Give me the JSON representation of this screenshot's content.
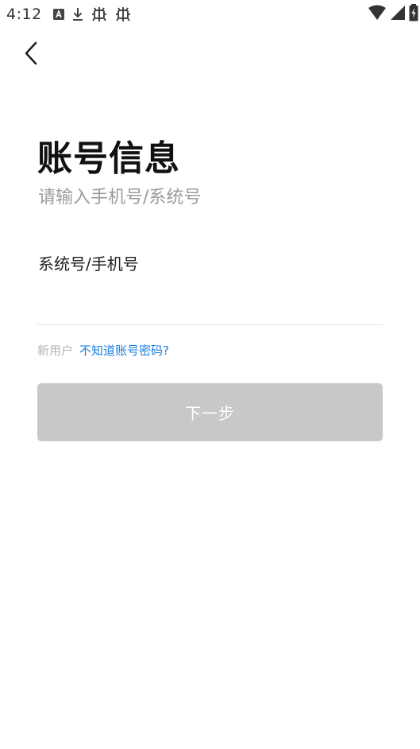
{
  "status_bar": {
    "time": "4:12",
    "left_icons": [
      "a-box-icon",
      "download-icon",
      "bug-icon",
      "bug-icon"
    ],
    "right_icons": [
      "wifi-icon",
      "signal-icon",
      "battery-icon"
    ]
  },
  "nav": {
    "back_icon": "chevron-left-icon"
  },
  "header": {
    "title": "账号信息",
    "subtitle": "请输入手机号/系统号"
  },
  "form": {
    "account_label": "系统号/手机号",
    "account_value": "",
    "account_placeholder": ""
  },
  "hint": {
    "new_user": "新用户",
    "forgot_link": "不知道账号密码?"
  },
  "actions": {
    "next_label": "下一步"
  },
  "colors": {
    "link": "#1a7fe0",
    "button_disabled": "#c8c8c8",
    "subtitle": "#9b9b9b"
  }
}
